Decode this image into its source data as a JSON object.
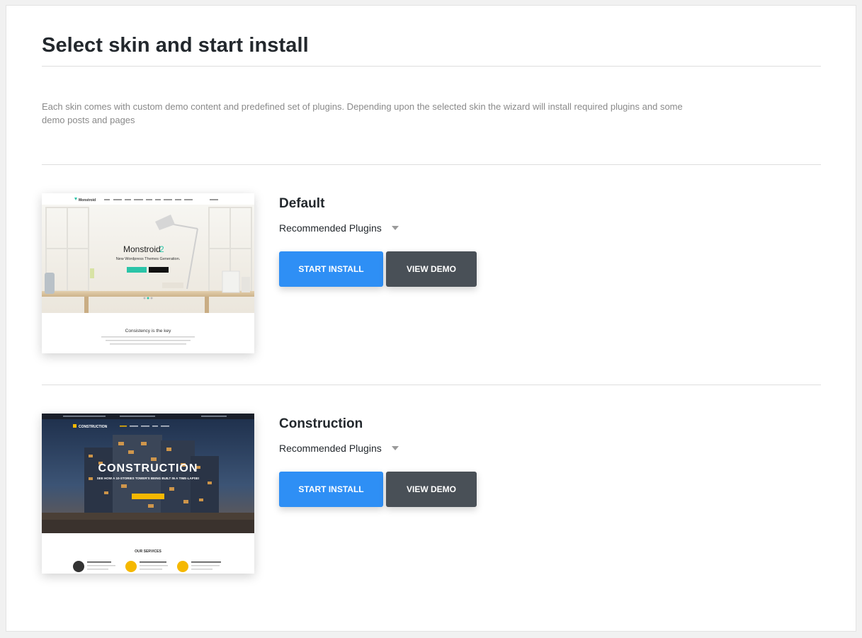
{
  "page": {
    "title": "Select skin and start install",
    "description": "Each skin comes with custom demo content and predefined set of plugins. Depending upon the selected skin the wizard will install required plugins and some demo posts and pages"
  },
  "skins": [
    {
      "name": "Default",
      "plugins_label": "Recommended Plugins",
      "install_label": "START INSTALL",
      "demo_label": "VIEW DEMO",
      "thumbnail": {
        "logo": "Monstroid",
        "hero_title": "Monstroid",
        "hero_number": "2",
        "hero_subtitle": "New Wordpress Themes Generation.",
        "section_title": "Consistency is the key"
      }
    },
    {
      "name": "Construction",
      "plugins_label": "Recommended Plugins",
      "install_label": "START INSTALL",
      "demo_label": "VIEW DEMO",
      "thumbnail": {
        "logo": "CONSTRUCTION",
        "hero_title": "CONSTRUCTION",
        "hero_subtitle": "SEE HOW A 10-STORIES TOWER'S BEING BUILT IN A TIME-LAPSE!",
        "services_title": "OUR SERVICES"
      }
    }
  ],
  "colors": {
    "install_button": "#2e8ff5",
    "demo_button": "#495057",
    "accent_teal": "#2bc4a8",
    "accent_yellow": "#f5b800"
  }
}
